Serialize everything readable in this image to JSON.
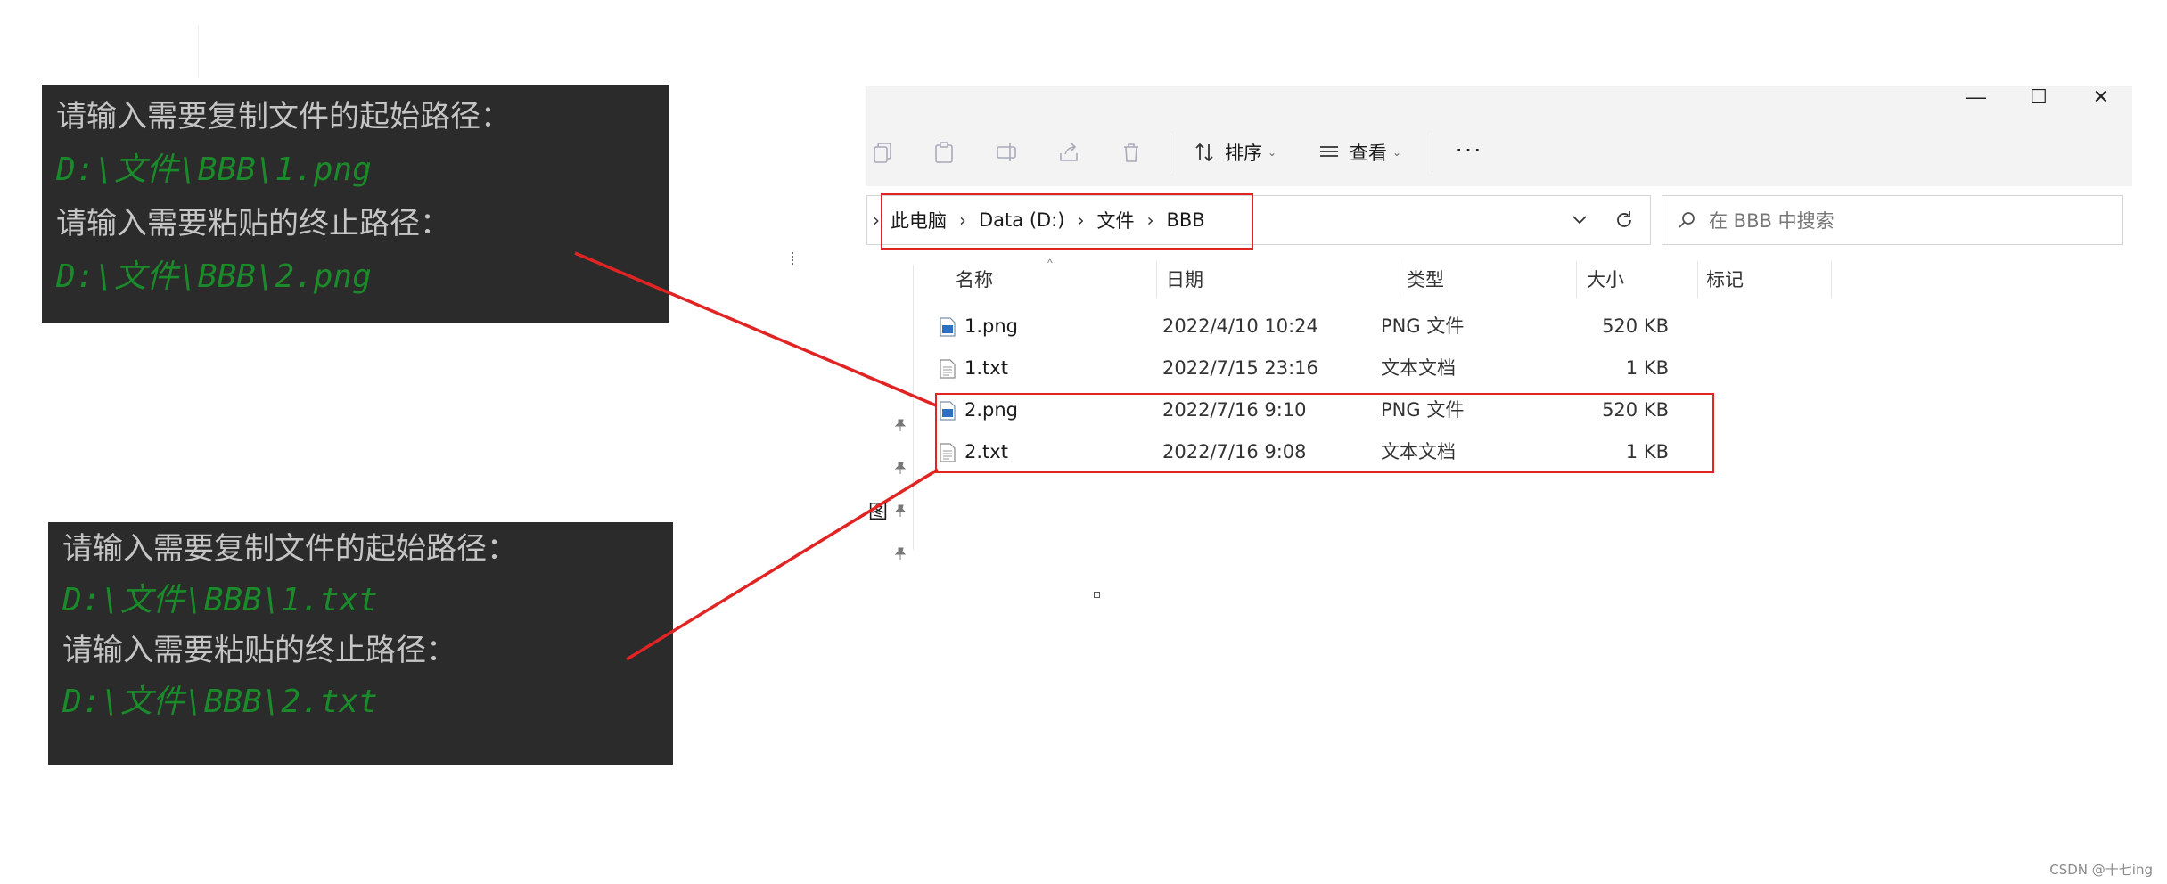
{
  "console_top": {
    "lines": [
      {
        "kind": "prompt",
        "text": "请输入需要复制文件的起始路径："
      },
      {
        "kind": "path",
        "text": "D:\\文件\\BBB\\1.png"
      },
      {
        "kind": "prompt",
        "text": "请输入需要粘贴的终止路径："
      },
      {
        "kind": "path",
        "text": "D:\\文件\\BBB\\2.png"
      }
    ]
  },
  "console_bottom": {
    "lines": [
      {
        "kind": "prompt",
        "text": "请输入需要复制文件的起始路径："
      },
      {
        "kind": "path",
        "text": "D:\\文件\\BBB\\1.txt"
      },
      {
        "kind": "prompt",
        "text": "请输入需要粘贴的终止路径："
      },
      {
        "kind": "path",
        "text": "D:\\文件\\BBB\\2.txt"
      }
    ]
  },
  "explorer": {
    "window_controls": {
      "minimize": "—",
      "maximize": "☐",
      "close": "✕"
    },
    "toolbar": {
      "icons": [
        "copy-icon",
        "paste-icon",
        "rename-icon",
        "share-icon",
        "delete-icon"
      ],
      "sort_label": "排序",
      "view_label": "查看",
      "more_label": "···"
    },
    "address": {
      "crumbs": [
        "此电脑",
        "Data (D:)",
        "文件",
        "BBB"
      ]
    },
    "search": {
      "placeholder": "在 BBB 中搜索"
    },
    "columns": {
      "name": "名称",
      "date": "日期",
      "type": "类型",
      "size": "大小",
      "tags": "标记"
    },
    "files": [
      {
        "name": "1.png",
        "date": "2022/4/10 10:24",
        "type": "PNG 文件",
        "size": "520 KB",
        "icon": "image-file-icon"
      },
      {
        "name": "1.txt",
        "date": "2022/7/15 23:16",
        "type": "文本文档",
        "size": "1 KB",
        "icon": "text-file-icon"
      },
      {
        "name": "2.png",
        "date": "2022/7/16 9:10",
        "type": "PNG 文件",
        "size": "520 KB",
        "icon": "image-file-icon"
      },
      {
        "name": "2.txt",
        "date": "2022/7/16 9:08",
        "type": "文本文档",
        "size": "1 KB",
        "icon": "text-file-icon"
      }
    ],
    "left_pane_label": "图"
  },
  "annotation_color": "#e02424",
  "watermark": "CSDN @十七ing"
}
